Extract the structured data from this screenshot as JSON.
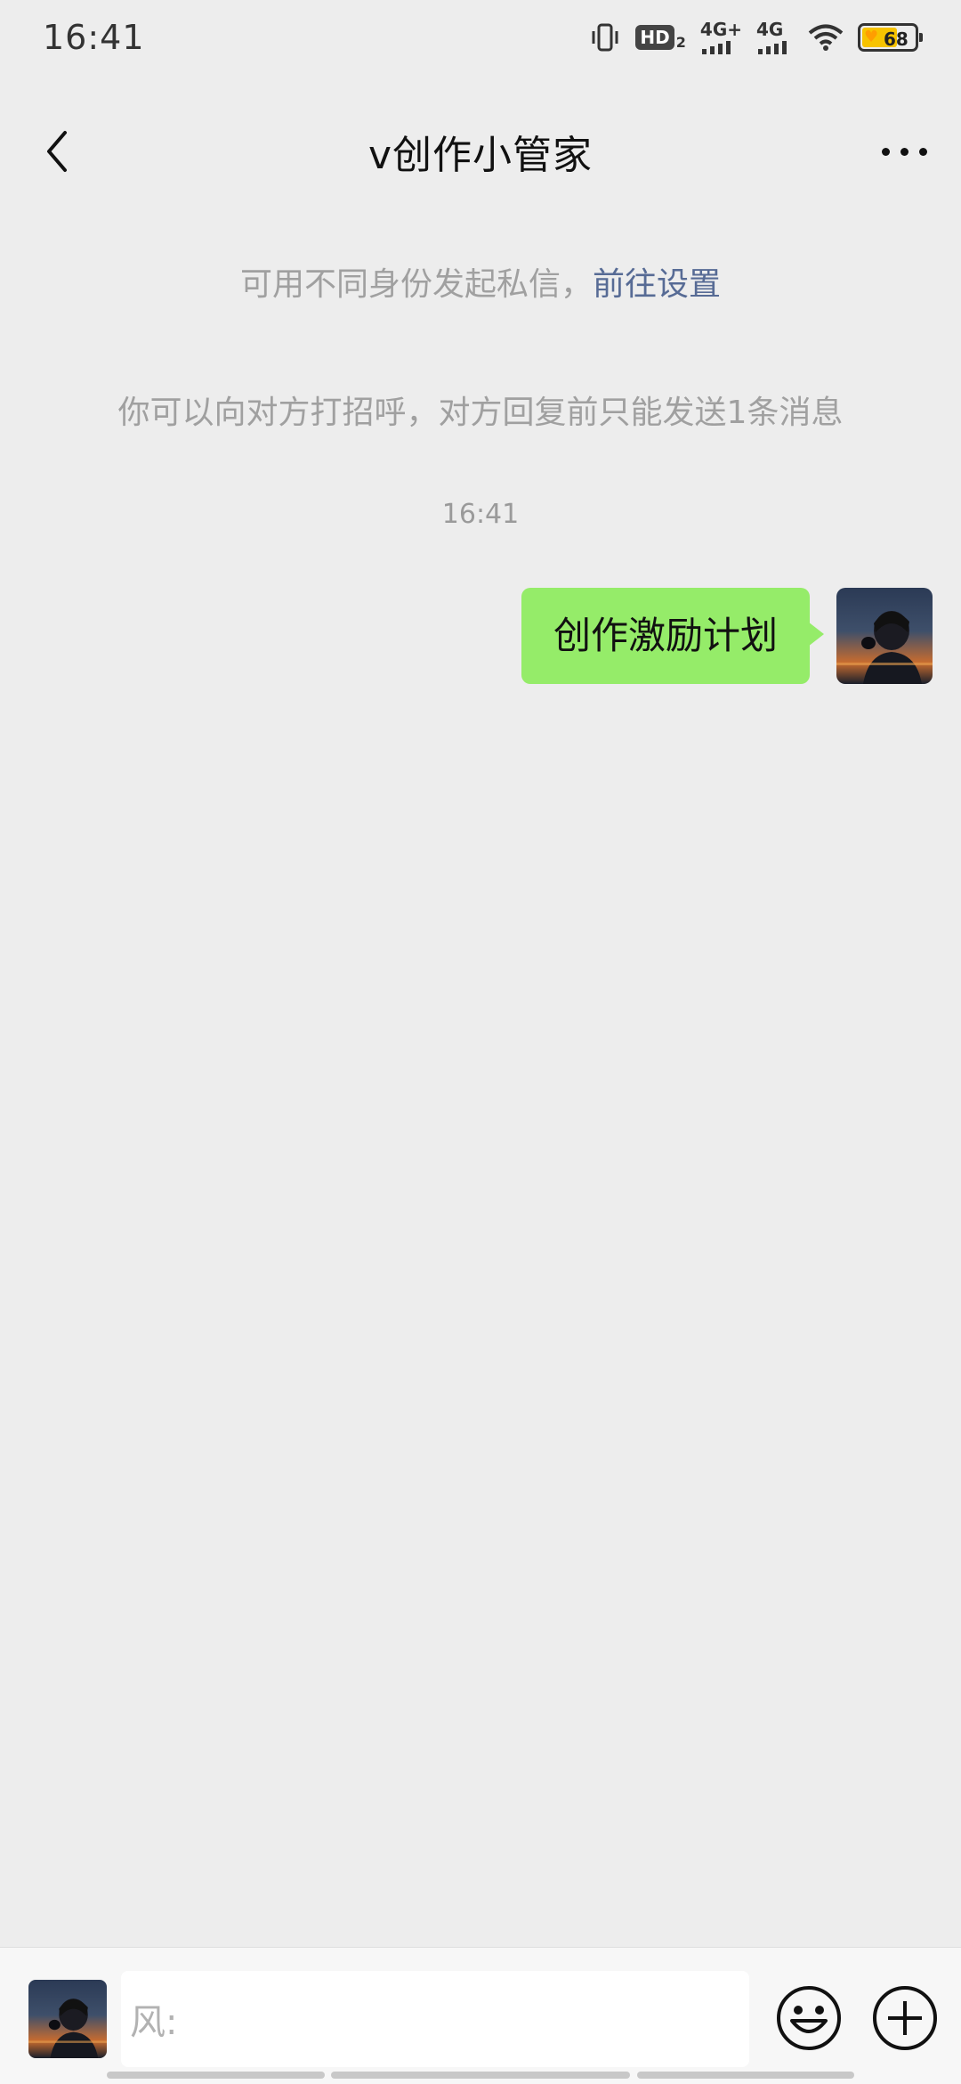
{
  "status_bar": {
    "time": "16:41",
    "hd_label": "HD",
    "hd_sub": "2",
    "sim1_label": "4G+",
    "sim2_label": "4G",
    "battery_level": "68",
    "icons": [
      "vibrate-icon",
      "hd-icon",
      "signal-icon",
      "signal-icon",
      "wifi-icon",
      "battery-icon"
    ]
  },
  "header": {
    "title": "v创作小管家",
    "back_icon": "chevron-left-icon",
    "more_icon": "more-icon"
  },
  "notices": {
    "identity_text": "可用不同身份发起私信，",
    "identity_link": "前往设置",
    "limit_text": "你可以向对方打招呼，对方回复前只能发送1条消息"
  },
  "chat": {
    "timestamp": "16:41",
    "messages": [
      {
        "from": "me",
        "text": "创作激励计划"
      }
    ]
  },
  "input_bar": {
    "placeholder": "风:",
    "emoji_icon": "emoji-icon",
    "plus_icon": "plus-icon"
  },
  "colors": {
    "background": "#ededed",
    "bubble_green": "#95ec69",
    "link_blue": "#576b95",
    "notice_gray": "#a0a0a0"
  }
}
